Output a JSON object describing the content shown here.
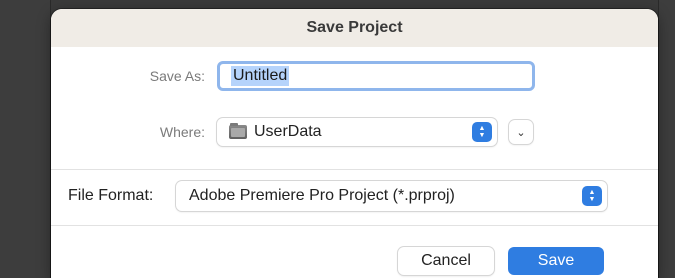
{
  "dialog": {
    "title": "Save Project"
  },
  "save_as": {
    "label": "Save As:",
    "value": "Untitled"
  },
  "where": {
    "label": "Where:",
    "value": "UserData",
    "icon": "folder-icon"
  },
  "file_format": {
    "label": "File Format:",
    "value": "Adobe Premiere Pro Project (*.prproj)"
  },
  "buttons": {
    "cancel_label": "Cancel",
    "save_label": "Save"
  },
  "colors": {
    "accent": "#2f7de1",
    "titlebar": "#f0ece6",
    "selection": "#b5d3fb"
  }
}
